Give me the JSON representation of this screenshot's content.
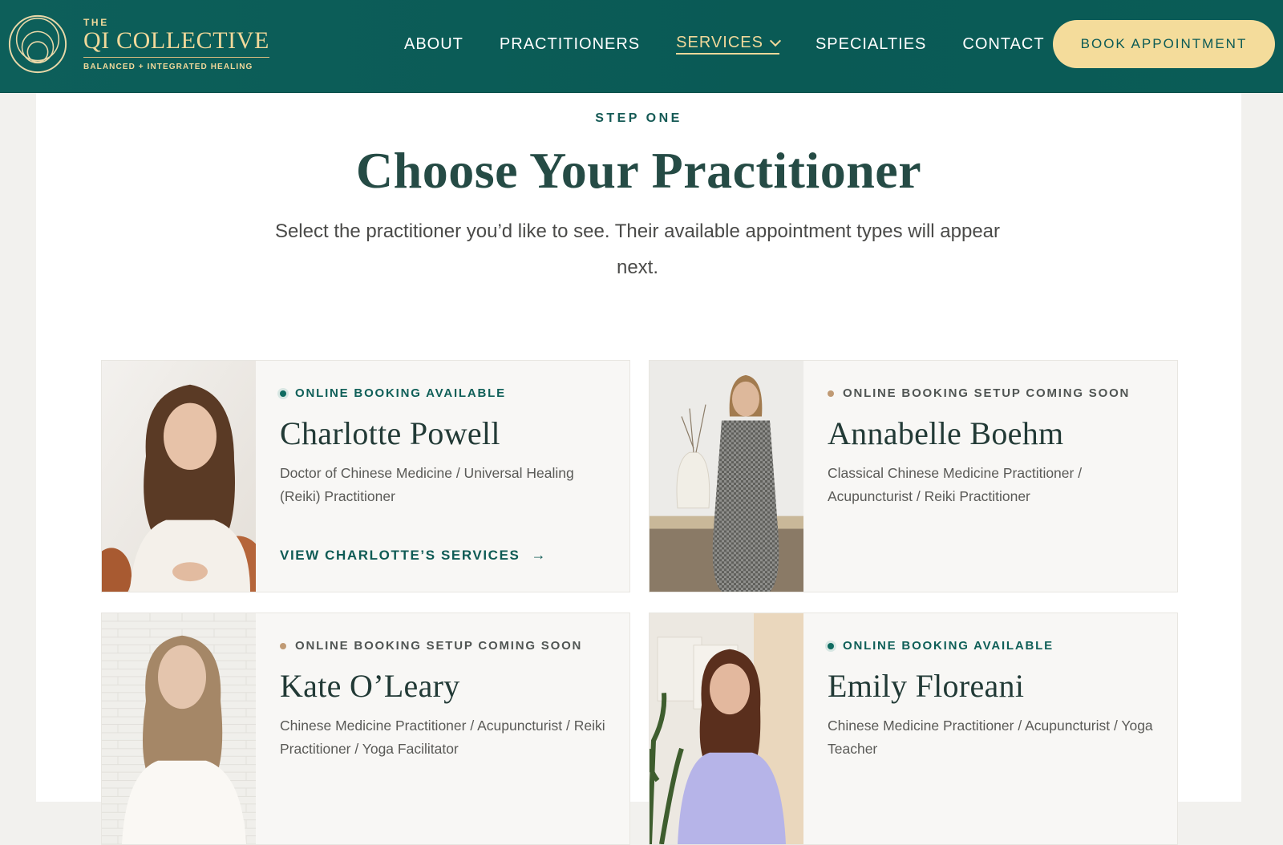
{
  "header": {
    "logo": {
      "the": "THE",
      "name": "QI COLLECTIVE",
      "tagline": "BALANCED + INTEGRATED HEALING"
    },
    "nav": [
      {
        "label": "ABOUT"
      },
      {
        "label": "PRACTITIONERS"
      },
      {
        "label": "SERVICES",
        "active": true
      },
      {
        "label": "SPECIALTIES"
      },
      {
        "label": "CONTACT"
      }
    ],
    "cta": "BOOK APPOINTMENT"
  },
  "main": {
    "step": "STEP ONE",
    "title": "Choose Your Practitioner",
    "intro": "Select the practitioner you’d like to see. Their available appointment types will appear next."
  },
  "practitioners": [
    {
      "status": "ONLINE BOOKING AVAILABLE",
      "name": "Charlotte Powell",
      "role": "Doctor of Chinese Medicine / Universal Healing (Reiki) Practitioner",
      "link": "VIEW CHARLOTTE’S SERVICES"
    },
    {
      "status": "ONLINE BOOKING SETUP COMING SOON",
      "name": "Annabelle Boehm",
      "role": "Classical Chinese Medicine Practitioner / Acupuncturist / Reiki Practitioner"
    },
    {
      "status": "ONLINE BOOKING SETUP COMING SOON",
      "name": "Kate O’Leary",
      "role": "Chinese Medicine Practitioner / Acupuncturist / Reiki Practitioner / Yoga Facilitator"
    },
    {
      "status": "ONLINE BOOKING AVAILABLE",
      "name": "Emily Floreani",
      "role": "Chinese Medicine Practitioner / Acupuncturist / Yoga Teacher"
    }
  ],
  "colors": {
    "header_bg": "#0b5c57",
    "gold": "#f0d89a",
    "cta_bg": "#f4dc9b",
    "teal_text": "#0f5b55",
    "coming_soon_dot": "#c09a74"
  },
  "icons": [
    "logo-circles-icon",
    "chevron-down-icon",
    "arrow-right-icon",
    "status-dot-icon"
  ]
}
